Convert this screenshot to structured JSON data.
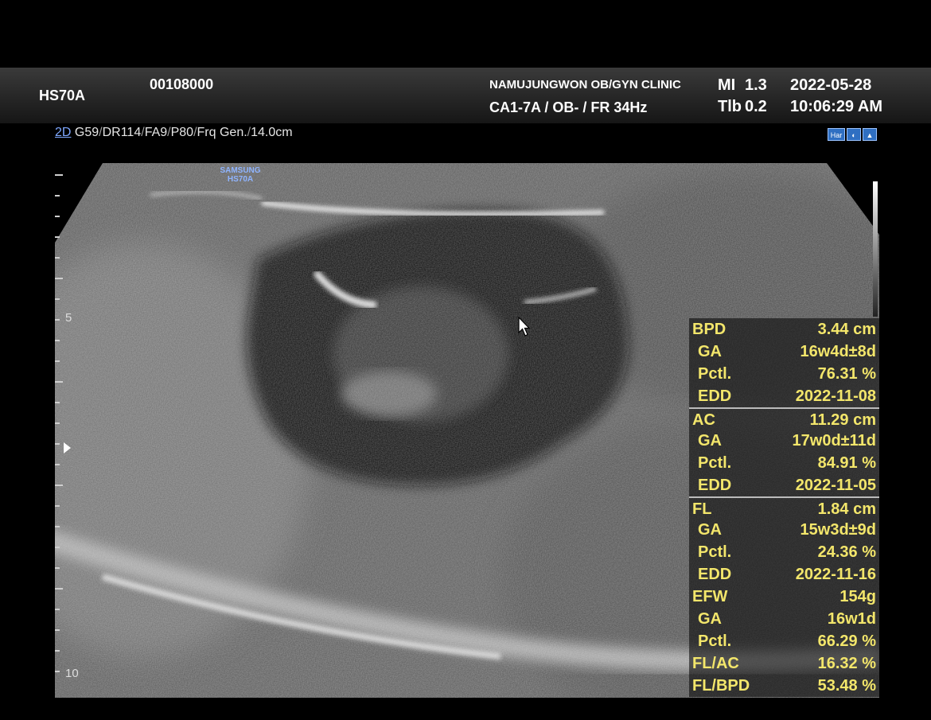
{
  "header": {
    "device": "HS70A",
    "patient_id": "00108000",
    "clinic": "NAMUJUNGWON OB/GYN CLINIC",
    "probe_info": "CA1-7A / OB- / FR 34Hz",
    "mi_label": "MI",
    "mi_value": "1.3",
    "tib_label": "Tlb",
    "tib_value": "0.2",
    "date": "2022-05-28",
    "time": "10:06:29 AM"
  },
  "scan": {
    "mode": "2D",
    "params": [
      "G59",
      "DR114",
      "FA9",
      "P80",
      "Frq Gen.",
      "14.0cm"
    ]
  },
  "icons": [
    {
      "name": "harmonic-icon",
      "label": "Har"
    },
    {
      "name": "fetal-icon",
      "label": "◐"
    },
    {
      "name": "mode-icon",
      "label": "▲"
    }
  ],
  "logo": {
    "line1": "SAMSUNG",
    "line2": "HS70A"
  },
  "depth_scale": {
    "label_5": "5",
    "label_10": "10"
  },
  "measurements": [
    {
      "label": "BPD",
      "value": "3.44 cm",
      "sub": false,
      "divider": false
    },
    {
      "label": "GA",
      "value": "16w4d±8d",
      "sub": true,
      "divider": false
    },
    {
      "label": "Pctl.",
      "value": "76.31 %",
      "sub": true,
      "divider": false
    },
    {
      "label": "EDD",
      "value": "2022-11-08",
      "sub": true,
      "divider": false
    },
    {
      "label": "AC",
      "value": "11.29 cm",
      "sub": false,
      "divider": true
    },
    {
      "label": "GA",
      "value": "17w0d±11d",
      "sub": true,
      "divider": false
    },
    {
      "label": "Pctl.",
      "value": "84.91 %",
      "sub": true,
      "divider": false
    },
    {
      "label": "EDD",
      "value": "2022-11-05",
      "sub": true,
      "divider": false
    },
    {
      "label": "FL",
      "value": "1.84 cm",
      "sub": false,
      "divider": true
    },
    {
      "label": "GA",
      "value": "15w3d±9d",
      "sub": true,
      "divider": false
    },
    {
      "label": "Pctl.",
      "value": "24.36 %",
      "sub": true,
      "divider": false
    },
    {
      "label": "EDD",
      "value": "2022-11-16",
      "sub": true,
      "divider": false
    },
    {
      "label": "EFW",
      "value": "154g",
      "sub": false,
      "divider": false
    },
    {
      "label": "GA",
      "value": "16w1d",
      "sub": true,
      "divider": false
    },
    {
      "label": "Pctl.",
      "value": "66.29 %",
      "sub": true,
      "divider": false
    },
    {
      "label": "FL/AC",
      "value": "16.32 %",
      "sub": false,
      "divider": false
    },
    {
      "label": "FL/BPD",
      "value": "53.48 %",
      "sub": false,
      "divider": false
    }
  ]
}
